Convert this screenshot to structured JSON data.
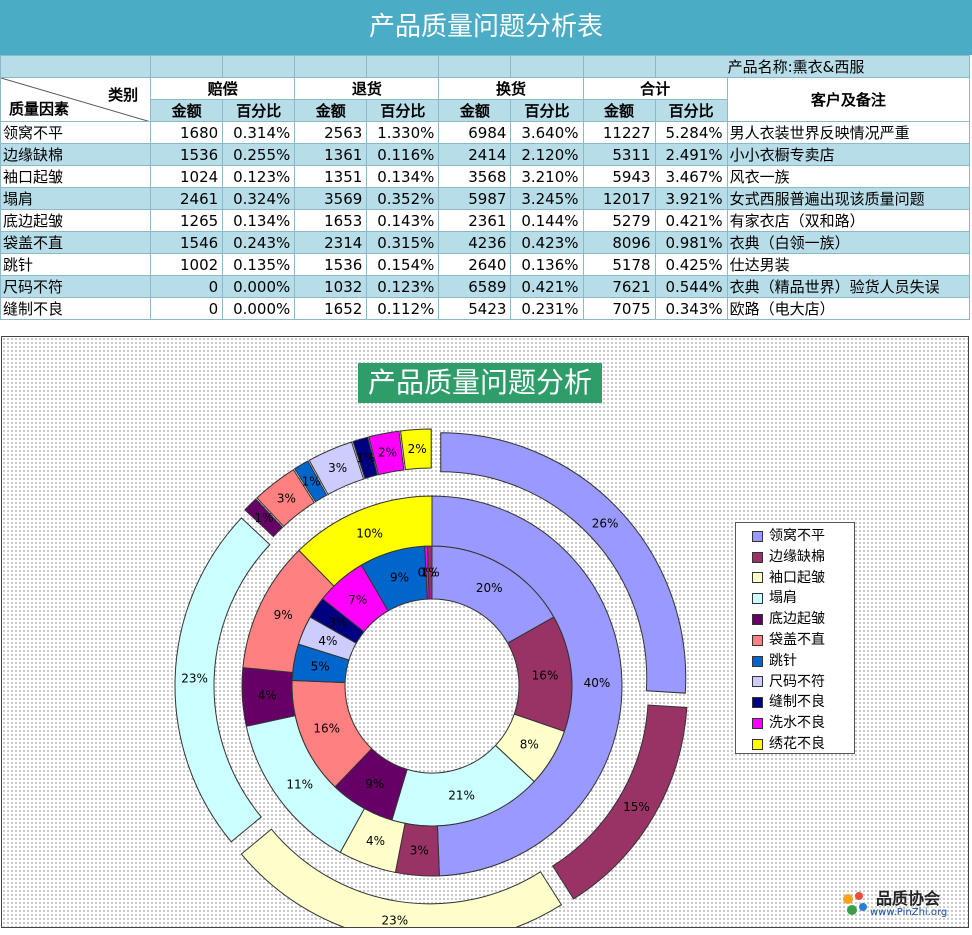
{
  "title": "产品质量问题分析表",
  "product_label": "产品名称:",
  "product_name": "熏衣&西服",
  "header": {
    "category": "类别",
    "factor": "质量因素",
    "groups": [
      "赔偿",
      "退货",
      "换货",
      "合计"
    ],
    "amount": "金额",
    "percent": "百分比",
    "note": "客户及备注"
  },
  "rows": [
    {
      "name": "领窝不平",
      "v": [
        "1680",
        "0.314%",
        "2563",
        "1.330%",
        "6984",
        "3.640%",
        "11227",
        "5.284%"
      ],
      "note": "男人衣装世界反映情况严重"
    },
    {
      "name": "边缘缺棉",
      "v": [
        "1536",
        "0.255%",
        "1361",
        "0.116%",
        "2414",
        "2.120%",
        "5311",
        "2.491%"
      ],
      "note": "小小衣橱专卖店"
    },
    {
      "name": "袖口起皱",
      "v": [
        "1024",
        "0.123%",
        "1351",
        "0.134%",
        "3568",
        "3.210%",
        "5943",
        "3.467%"
      ],
      "note": "风衣一族"
    },
    {
      "name": "塌肩",
      "v": [
        "2461",
        "0.324%",
        "3569",
        "0.352%",
        "5987",
        "3.245%",
        "12017",
        "3.921%"
      ],
      "note": "女式西服普遍出现该质量问题"
    },
    {
      "name": "底边起皱",
      "v": [
        "1265",
        "0.134%",
        "1653",
        "0.143%",
        "2361",
        "0.144%",
        "5279",
        "0.421%"
      ],
      "note": "有家衣店（双和路）"
    },
    {
      "name": "袋盖不直",
      "v": [
        "1546",
        "0.243%",
        "2314",
        "0.315%",
        "4236",
        "0.423%",
        "8096",
        "0.981%"
      ],
      "note": "衣典（白领一族）"
    },
    {
      "name": "跳针",
      "v": [
        "1002",
        "0.135%",
        "1536",
        "0.154%",
        "2640",
        "0.136%",
        "5178",
        "0.425%"
      ],
      "note": "仕达男装"
    },
    {
      "name": "尺码不符",
      "v": [
        "0",
        "0.000%",
        "1032",
        "0.123%",
        "6589",
        "0.421%",
        "7621",
        "0.544%"
      ],
      "note": "衣典（精品世界）验货人员失误"
    },
    {
      "name": "缝制不良",
      "v": [
        "0",
        "0.000%",
        "1652",
        "0.112%",
        "5423",
        "0.231%",
        "7075",
        "0.343%"
      ],
      "note": "欧路（电大店）"
    }
  ],
  "chart_data": {
    "type": "doughnut",
    "title": "产品质量问题分析",
    "legend_position": "right",
    "categories": [
      "领窝不平",
      "边缘缺棉",
      "袖口起皱",
      "塌肩",
      "底边起皱",
      "袋盖不直",
      "跳针",
      "尺码不符",
      "缝制不良",
      "洗水不良",
      "绣花不良"
    ],
    "colors": [
      "#9999ff",
      "#993366",
      "#ffffcc",
      "#ccffff",
      "#660066",
      "#ff8080",
      "#0066cc",
      "#ccccff",
      "#000080",
      "#ff00ff",
      "#ffff00"
    ],
    "rings": [
      {
        "values": [
          20,
          16,
          8,
          21,
          9,
          16,
          5,
          4,
          3,
          7,
          9,
          0.4,
          0.6
        ],
        "labels": [
          "20%",
          "16%",
          "8%",
          "21%",
          "9%",
          "16%",
          "5%",
          "4%",
          "3%",
          "7%",
          "9%",
          "0%",
          "1%"
        ],
        "colors_index": [
          0,
          1,
          2,
          3,
          4,
          5,
          6,
          7,
          8,
          9,
          6,
          9,
          1
        ]
      },
      {
        "values": [
          40,
          3,
          4,
          11,
          4,
          9,
          0,
          0,
          0,
          0,
          10,
          0,
          0
        ],
        "labels": [
          "40%",
          "3%",
          "4%",
          "11%",
          "4%",
          "9%",
          "",
          "",
          "",
          "",
          "10%",
          "",
          ""
        ],
        "colors_index": [
          0,
          1,
          2,
          3,
          4,
          5,
          6,
          7,
          8,
          9,
          10,
          9,
          1
        ]
      },
      {
        "values": [
          26,
          15,
          23,
          23,
          1,
          3,
          1,
          3,
          1,
          2,
          2
        ],
        "labels": [
          "26%",
          "15%",
          "23%",
          "23%",
          "1%",
          "3%",
          "1%",
          "3%",
          "1%",
          "2%",
          "2%"
        ],
        "colors_index": [
          0,
          1,
          2,
          3,
          4,
          5,
          6,
          7,
          8,
          9,
          10
        ]
      }
    ]
  },
  "logo": {
    "name": "品质协会",
    "url": "www.PinZhi.org"
  }
}
